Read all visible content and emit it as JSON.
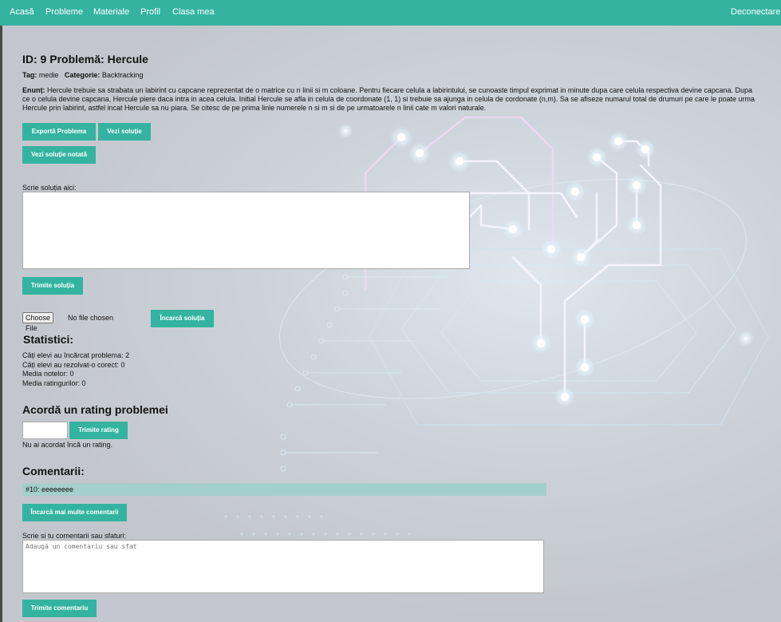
{
  "nav": {
    "items": [
      "Acasă",
      "Probleme",
      "Materiale",
      "Profil",
      "Clasa mea"
    ],
    "logout": "Deconectare"
  },
  "problem": {
    "id_label": "ID: 9",
    "title_label": "Problemă: Hercule",
    "tag_label": "Tag:",
    "tag_value": "medie",
    "category_label": "Categorie:",
    "category_value": "Backtracking",
    "statement_label": "Enunț:",
    "statement": "Hercule trebuie sa strabata un labirint cu capcane reprezentat de o matrice cu n linii si m coloane. Pentru fiecare celula a labirintului, se cunoaste timpul exprimat in minute dupa care celula respectiva devine capcana. Dupa ce o celula devine capcana, Hercule piere daca intra in acea celula. Initial Hercule se afla in celula de coordonate (1, 1) si trebuie sa ajunga in celula de cordonate (n,m). Sa se afiseze numarul total de drumuri pe care le poate urma Hercule prin labirint, astfel incat Hercule sa nu piara. Se citesc de pe prima linie numerele n si m si de pe urmatoarele n linii cate m valori naturale."
  },
  "buttons": {
    "export": "Exportă Problema",
    "view_solution": "Vezi soluție",
    "view_graded": "Vezi soluție notată",
    "submit_solution": "Trimite soluția",
    "upload_solution": "Încarcă soluția",
    "submit_rating": "Trimite rating",
    "load_more_comments": "Încarcă mai multe comentarii",
    "submit_comment": "Trimite comentariu"
  },
  "solution": {
    "label": "Scrie soluția aici:",
    "value": ""
  },
  "file": {
    "choose_label": "Choose File",
    "status": "No file chosen"
  },
  "stats": {
    "title": "Statistici:",
    "lines": [
      "Câți elevi au încărcat problema: 2",
      "Câți elevi au rezolvat-o corect: 0",
      "Media notelor: 0",
      "Media ratingurilor: 0"
    ]
  },
  "rating": {
    "title": "Acordă un rating problemei",
    "value": "",
    "note": "Nu ai acordat încă un rating."
  },
  "comments": {
    "title": "Comentarii:",
    "items": [
      "#10: eeeeeeee"
    ],
    "form_label": "Scrie si tu comentarii sau sfaturi:",
    "placeholder": "Adaugă un comentariu sau sfat"
  },
  "colors": {
    "accent": "#34b3a1",
    "comment_bg": "#a5cfcc",
    "background": "#c3c7cd"
  }
}
